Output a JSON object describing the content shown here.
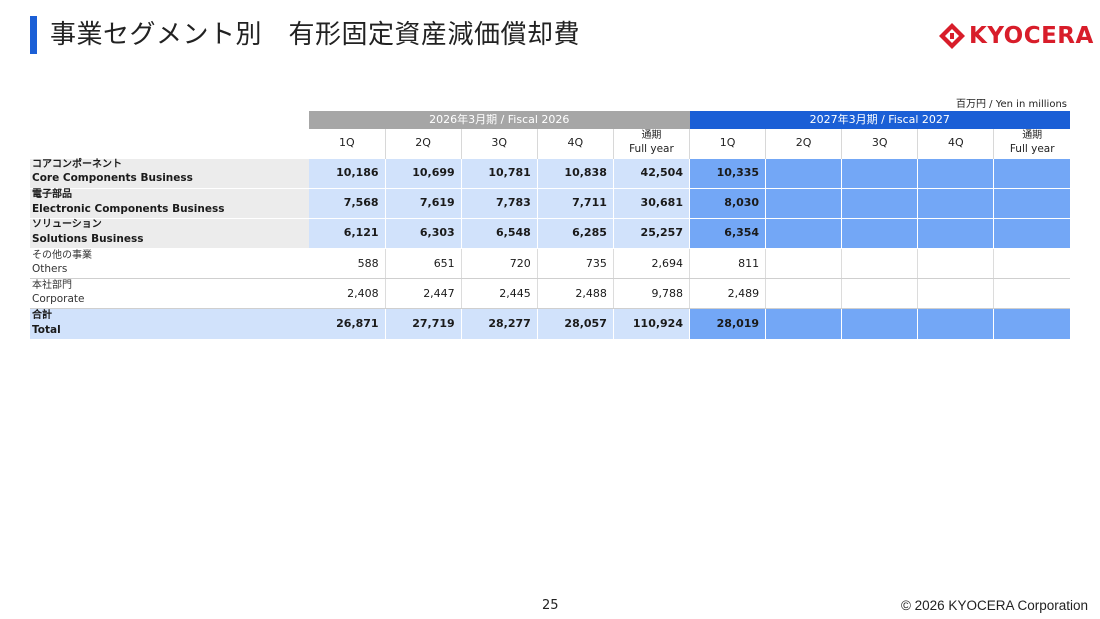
{
  "header": {
    "title": "事業セグメント別　有形固定資産減価償却費",
    "logo_text": "KYOCERA",
    "brand_color": "#d81d2a",
    "accent_color": "#1b5fd6"
  },
  "table": {
    "unit": "百万円 / Yen in millions",
    "fiscal_groups": [
      {
        "label": "2026年3月期 / Fiscal 2026"
      },
      {
        "label": "2027年3月期 / Fiscal 2027"
      }
    ],
    "columns": [
      "1Q",
      "2Q",
      "3Q",
      "4Q",
      "通期",
      "1Q",
      "2Q",
      "3Q",
      "4Q",
      "通期"
    ],
    "full_year_jp": "通期",
    "full_year_en": "Full year",
    "rows": [
      {
        "jp": "コアコンポーネント",
        "en": "Core Components Business",
        "bold": true,
        "values": [
          "10,186",
          "10,699",
          "10,781",
          "10,838",
          "42,504",
          "10,335",
          "",
          "",
          "",
          ""
        ]
      },
      {
        "jp": "電子部品",
        "en": "Electronic Components Business",
        "bold": true,
        "values": [
          "7,568",
          "7,619",
          "7,783",
          "7,711",
          "30,681",
          "8,030",
          "",
          "",
          "",
          ""
        ]
      },
      {
        "jp": "ソリューション",
        "en": "Solutions Business",
        "bold": true,
        "values": [
          "6,121",
          "6,303",
          "6,548",
          "6,285",
          "25,257",
          "6,354",
          "",
          "",
          "",
          ""
        ]
      },
      {
        "jp": "その他の事業",
        "en": "Others",
        "bold": false,
        "values": [
          "588",
          "651",
          "720",
          "735",
          "2,694",
          "811",
          "",
          "",
          "",
          ""
        ]
      },
      {
        "jp": "本社部門",
        "en": "Corporate",
        "bold": false,
        "values": [
          "2,408",
          "2,447",
          "2,445",
          "2,488",
          "9,788",
          "2,489",
          "",
          "",
          "",
          ""
        ]
      },
      {
        "jp": "合計",
        "en": "Total",
        "bold": true,
        "values": [
          "26,871",
          "27,719",
          "28,277",
          "28,057",
          "110,924",
          "28,019",
          "",
          "",
          "",
          ""
        ]
      }
    ]
  },
  "footer": {
    "page_number": "25",
    "copyright": "© 2026 KYOCERA Corporation"
  }
}
